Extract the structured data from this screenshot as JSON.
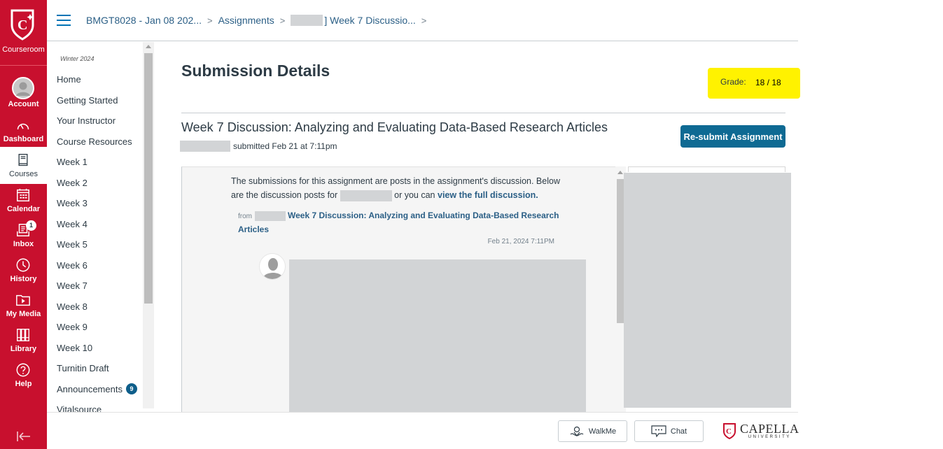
{
  "global_nav": {
    "logo_label": "Courseroom",
    "items": [
      {
        "label": "Account",
        "icon": "account-avatar-icon"
      },
      {
        "label": "Dashboard",
        "icon": "dashboard-gauge-icon"
      },
      {
        "label": "Courses",
        "icon": "courses-book-icon",
        "active": true
      },
      {
        "label": "Calendar",
        "icon": "calendar-icon"
      },
      {
        "label": "Inbox",
        "icon": "inbox-icon",
        "badge": "1"
      },
      {
        "label": "History",
        "icon": "history-clock-icon"
      },
      {
        "label": "My Media",
        "icon": "media-folder-play-icon"
      },
      {
        "label": "Library",
        "icon": "library-books-icon"
      },
      {
        "label": "Help",
        "icon": "help-question-icon"
      }
    ],
    "collapse_icon": "collapse-arrow-left-icon"
  },
  "breadcrumb": {
    "course": "BMGT8028 - Jan 08 202...",
    "assignments": "Assignments",
    "assignment": "] Week 7 Discussio..."
  },
  "course_nav": {
    "term": "Winter 2024",
    "items": [
      {
        "label": "Home"
      },
      {
        "label": "Getting Started"
      },
      {
        "label": "Your Instructor"
      },
      {
        "label": "Course Resources"
      },
      {
        "label": "Week 1"
      },
      {
        "label": "Week 2"
      },
      {
        "label": "Week 3"
      },
      {
        "label": "Week 4"
      },
      {
        "label": "Week 5"
      },
      {
        "label": "Week 6"
      },
      {
        "label": "Week 7"
      },
      {
        "label": "Week 8"
      },
      {
        "label": "Week 9"
      },
      {
        "label": "Week 10"
      },
      {
        "label": "Turnitin Draft"
      },
      {
        "label": "Announcements",
        "badge": "9"
      },
      {
        "label": "Vitalsource"
      }
    ]
  },
  "main": {
    "title": "Submission Details",
    "grade_label": "Grade:",
    "grade_value": "18 / 18",
    "assignment_title": "Week 7 Discussion: Analyzing and Evaluating Data-Based Research Articles",
    "submitted_text": "submitted Feb 21 at 7:11pm",
    "resubmit_label": "Re-submit Assignment",
    "highlight_color": "#fff200",
    "discussion": {
      "intro_1": "The submissions for this assignment are posts in the assignment's discussion. Below are the discussion posts for",
      "intro_2": "or you can",
      "link": "view the full discussion.",
      "from_label": "from",
      "topic_link": "Week 7 Discussion: Analyzing and Evaluating Data-Based Research Articles",
      "post_date": "Feb 21, 2024 7:11PM"
    }
  },
  "footer": {
    "walkme_label": "WalkMe",
    "chat_label": "Chat",
    "brand_name": "CAPELLA",
    "brand_sub": "UNIVERSITY"
  }
}
